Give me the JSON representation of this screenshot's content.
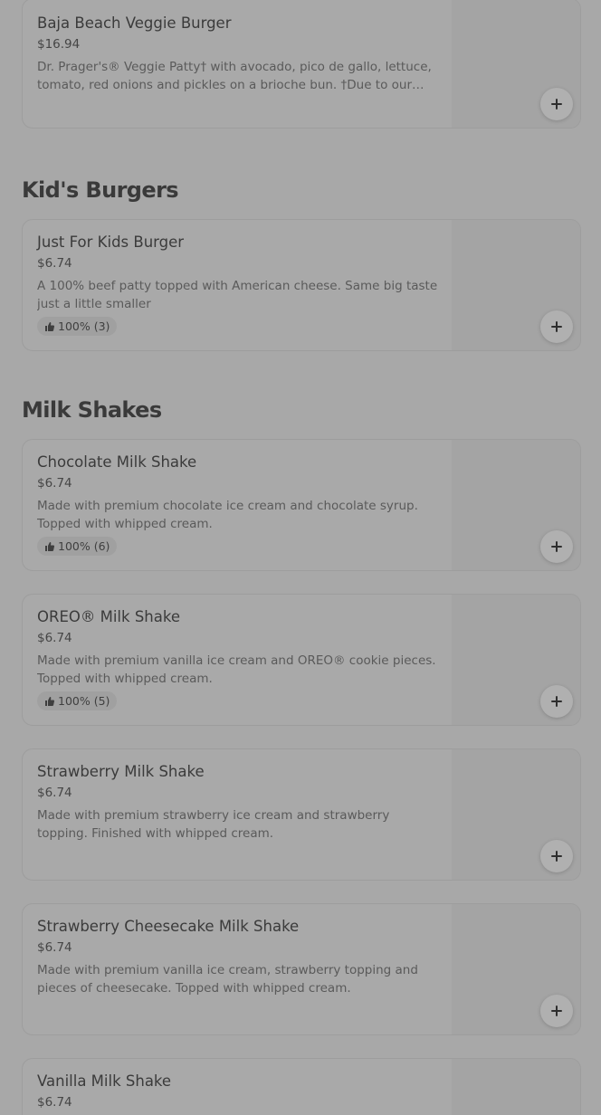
{
  "sections": [
    {
      "title": "",
      "items": [
        {
          "name": "Baja Beach Veggie Burger",
          "price": "$16.94",
          "description": "Dr. Prager's® Veggie Patty† with avocado, pico de gallo, lettuce, tomato, red onions and pickles on a brioche bun. †Due to our cookin..."
        }
      ]
    },
    {
      "title": "Kid's Burgers",
      "items": [
        {
          "name": "Just For Kids Burger",
          "price": "$6.74",
          "description": "A 100% beef patty topped with American cheese. Same big taste just a little smaller",
          "rating": "100% (3)"
        }
      ]
    },
    {
      "title": "Milk Shakes",
      "items": [
        {
          "name": "Chocolate Milk Shake",
          "price": "$6.74",
          "description": "Made with premium chocolate ice cream and chocolate syrup. Topped with whipped cream.",
          "rating": "100% (6)"
        },
        {
          "name": "OREO® Milk Shake",
          "price": "$6.74",
          "description": "Made with premium vanilla ice cream and OREO® cookie pieces. Topped with whipped cream.",
          "rating": "100% (5)"
        },
        {
          "name": "Strawberry Milk Shake",
          "price": "$6.74",
          "description": "Made with premium strawberry ice cream and strawberry topping. Finished with whipped cream."
        },
        {
          "name": "Strawberry Cheesecake Milk Shake",
          "price": "$6.74",
          "description": "Made with premium vanilla ice cream, strawberry topping and pieces of cheesecake. Topped with whipped cream."
        },
        {
          "name": "Vanilla Milk Shake",
          "price": "$6.74",
          "description": ""
        }
      ]
    }
  ],
  "icons": {
    "add": "plus-icon",
    "rating": "thumbs-up-icon"
  },
  "colors": {
    "overlay_background": "#a8a8a8",
    "text_primary": "#3a3a3a"
  }
}
